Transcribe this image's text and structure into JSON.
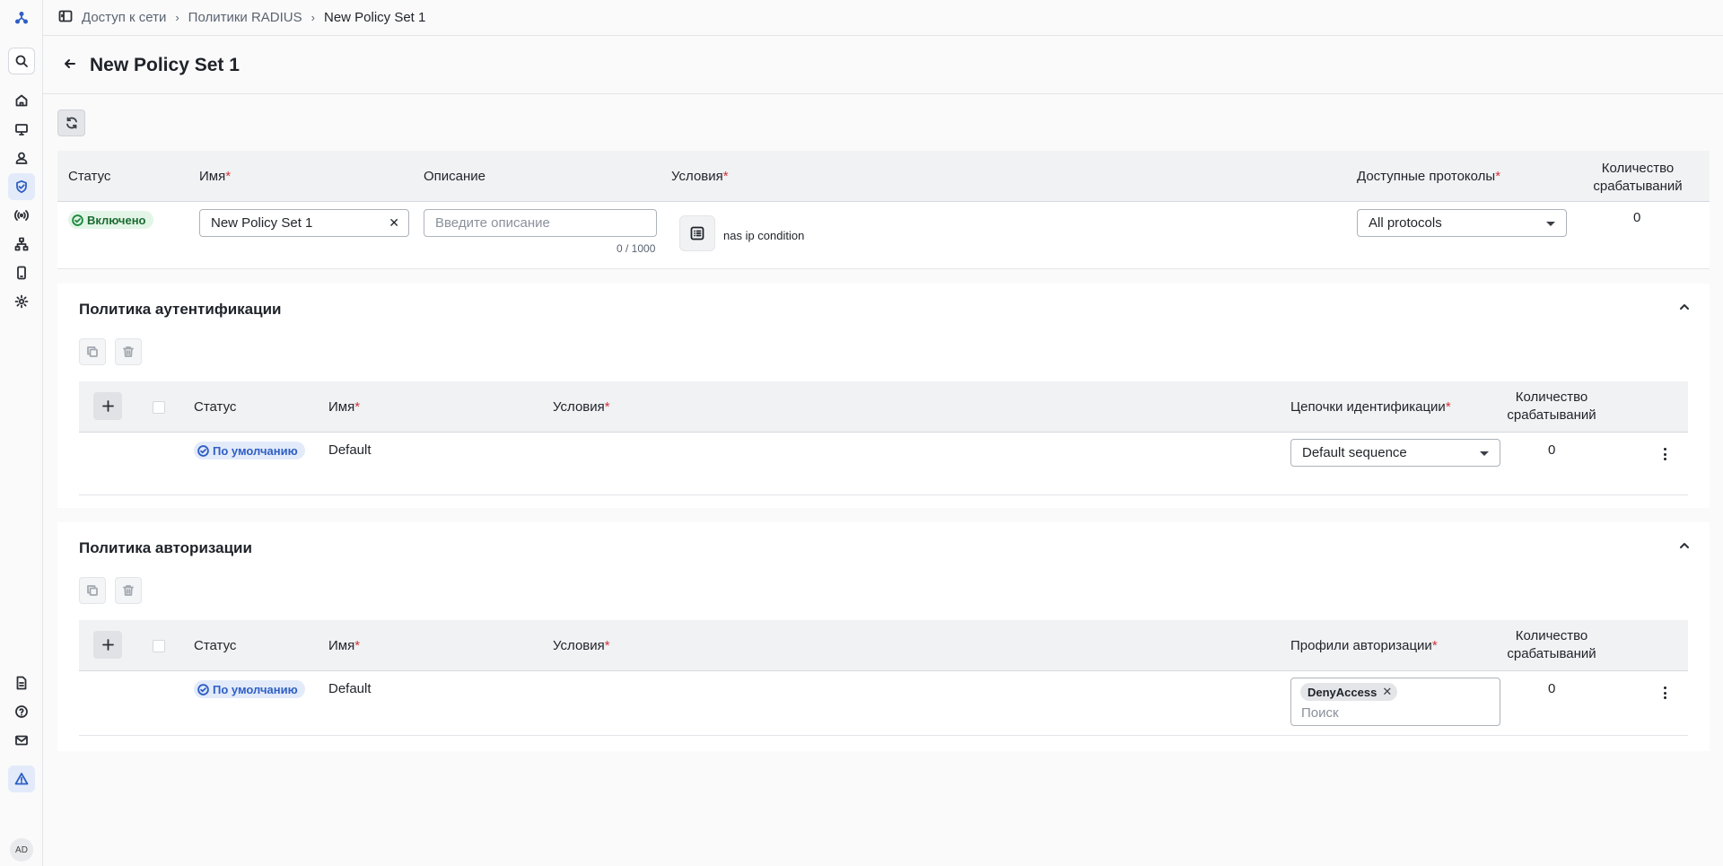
{
  "breadcrumb": {
    "items": [
      "Доступ к сети",
      "Политики RADIUS"
    ],
    "current": "New Policy Set 1"
  },
  "page": {
    "title": "New Policy Set 1"
  },
  "policy_set_table": {
    "columns": {
      "status": "Статус",
      "name": "Имя",
      "description": "Описание",
      "conditions": "Условия",
      "protocols": "Доступные протоколы",
      "hits_line1": "Количество",
      "hits_line2": "срабатываний"
    },
    "row": {
      "status": "Включено",
      "name": "New Policy Set 1",
      "description_placeholder": "Введите описание",
      "description_counter": "0 / 1000",
      "condition": "nas ip condition",
      "protocols": "All protocols",
      "hits": "0"
    }
  },
  "authentication": {
    "title": "Политика аутентификации",
    "columns": {
      "status": "Статус",
      "name": "Имя",
      "conditions": "Условия",
      "sequence": "Цепочки идентификации",
      "hits_line1": "Количество",
      "hits_line2": "срабатываний"
    },
    "row": {
      "status": "По умолчанию",
      "name": "Default",
      "sequence": "Default sequence",
      "hits": "0"
    }
  },
  "authorization": {
    "title": "Политика авторизации",
    "columns": {
      "status": "Статус",
      "name": "Имя",
      "conditions": "Условия",
      "profiles": "Профили авторизации",
      "hits_line1": "Количество",
      "hits_line2": "срабатываний"
    },
    "row": {
      "status": "По умолчанию",
      "name": "Default",
      "profile_chip": "DenyAccess",
      "search_placeholder": "Поиск",
      "hits": "0"
    }
  },
  "user": {
    "initials": "AD"
  },
  "required_mark": "*",
  "colors": {
    "accent": "#2f5fc4",
    "success": "#1b8a3d",
    "required": "#d1343b"
  }
}
